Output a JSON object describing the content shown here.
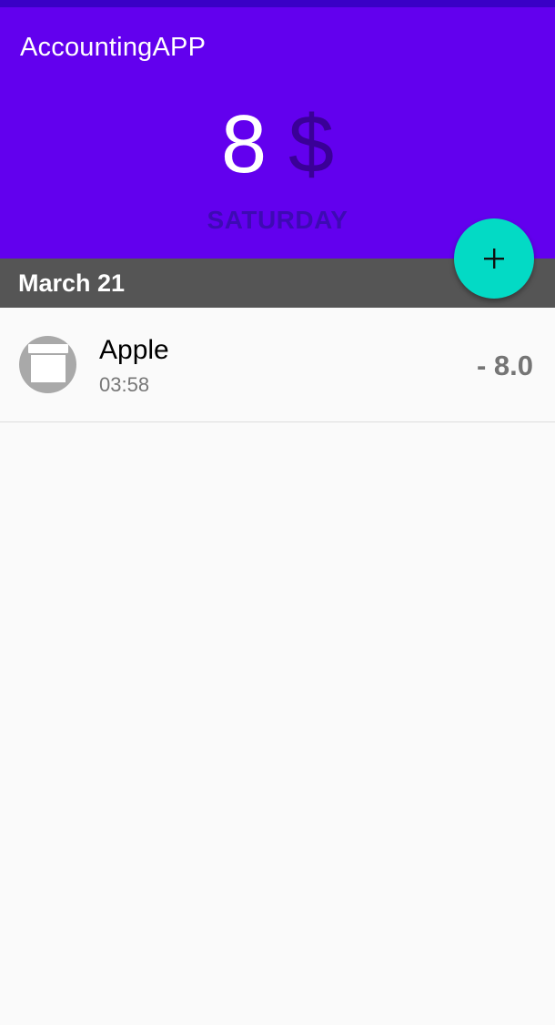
{
  "app": {
    "title": "AccountingAPP"
  },
  "summary": {
    "amount": "8",
    "currency": "$",
    "weekday": "SATURDAY"
  },
  "date_header": "March 21",
  "fab": {
    "label": "+"
  },
  "entries": [
    {
      "title": "Apple",
      "time": "03:58",
      "amount": "- 8.0",
      "icon": "archive-box-icon"
    }
  ],
  "colors": {
    "primary": "#6200ee",
    "primary_dark": "#3a00c6",
    "accent": "#03dac5",
    "date_bar": "#555555",
    "background": "#fafafa"
  }
}
